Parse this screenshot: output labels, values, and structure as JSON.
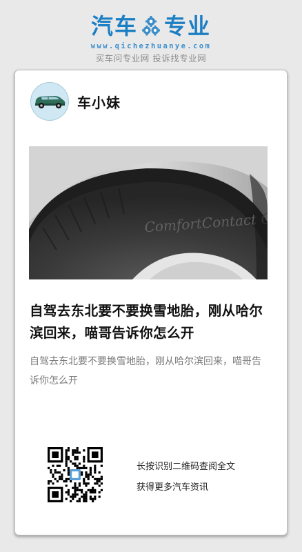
{
  "brand": {
    "left_word": "汽车",
    "right_word": "专业",
    "gear_icon": "gear-icon",
    "url": "www.qichezhuanye.com",
    "slogan": "买车问专业网 投诉找专业网",
    "color": "#1c7fc4"
  },
  "author": {
    "name": "车小妹",
    "avatar_icon": "car-avatar-icon"
  },
  "article": {
    "cover_alt": "tire-photo",
    "title": "自驾去东北要不要换雪地胎，刚从哈尔滨回来，喵哥告诉你怎么开",
    "summary": "自驾去东北要不要换雪地胎，刚从哈尔滨回来，喵哥告诉你怎么开"
  },
  "qr": {
    "icon": "qr-code-icon",
    "line1": "长按识别二维码查阅全文",
    "line2": "获得更多汽车资讯"
  }
}
